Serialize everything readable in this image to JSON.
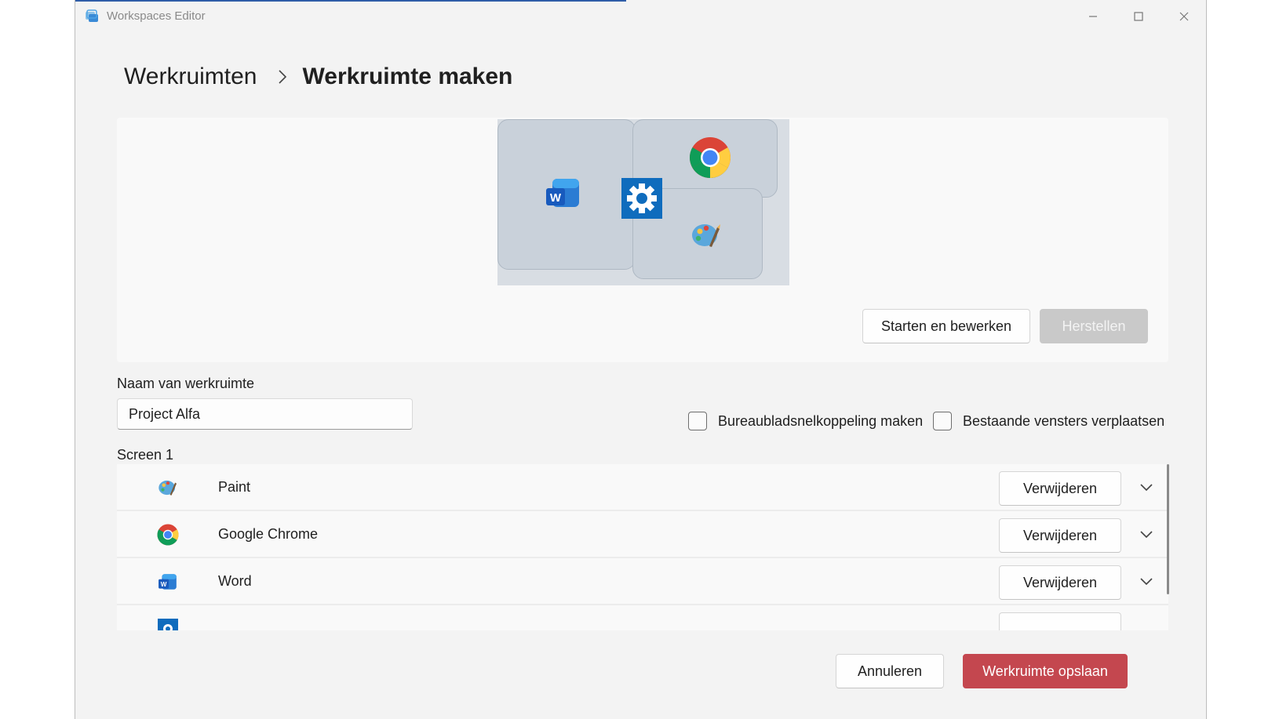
{
  "window": {
    "title": "Workspaces Editor",
    "controls": {
      "minimize": "minimize",
      "maximize": "maximize",
      "close": "close"
    }
  },
  "breadcrumb": {
    "root": "Werkruimten",
    "current": "Werkruimte maken"
  },
  "preview": {
    "buttons": {
      "launch_edit": "Starten en bewerken",
      "revert": "Herstellen"
    }
  },
  "form": {
    "name_label": "Naam van werkruimte",
    "name_value": "Project Alfa",
    "checkboxes": [
      {
        "label": "Bureaubladsnelkoppeling maken",
        "checked": false
      },
      {
        "label": "Bestaande vensters verplaatsen",
        "checked": false
      }
    ]
  },
  "screen": {
    "label": "Screen 1",
    "apps": [
      {
        "name": "Paint",
        "icon": "paint-icon",
        "remove_label": "Verwijderen"
      },
      {
        "name": "Google Chrome",
        "icon": "chrome-icon",
        "remove_label": "Verwijderen"
      },
      {
        "name": "Word",
        "icon": "word-icon",
        "remove_label": "Verwijderen"
      },
      {
        "name": "",
        "icon": "settings-icon",
        "remove_label": ""
      }
    ]
  },
  "footer": {
    "cancel": "Annuleren",
    "save": "Werkruimte opslaan"
  },
  "colors": {
    "accent": "#2f5da8",
    "primary_button": "#c4474f",
    "window_bg": "#f3f3f3"
  }
}
